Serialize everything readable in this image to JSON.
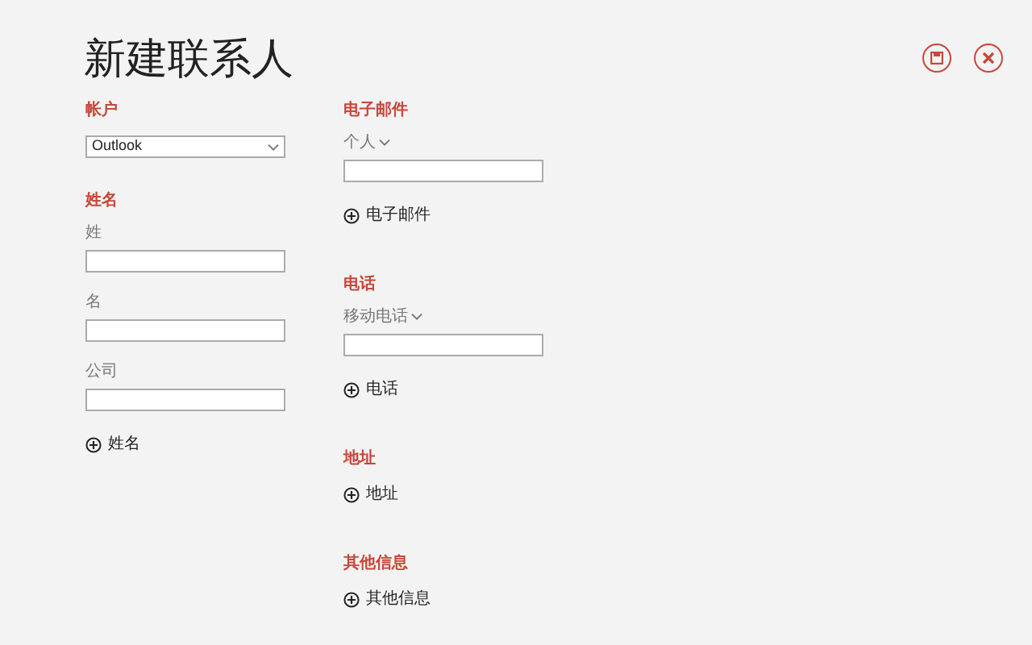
{
  "title": "新建联系人",
  "columns": [
    {
      "sections": [
        {
          "heading": "帐户",
          "items": [
            {
              "kind": "select",
              "value": "Outlook"
            }
          ]
        },
        {
          "heading": "姓名",
          "items": [
            {
              "kind": "field",
              "label": "姓"
            },
            {
              "kind": "field",
              "label": "名"
            },
            {
              "kind": "field",
              "label": "公司"
            },
            {
              "kind": "add",
              "label": "姓名"
            }
          ]
        }
      ]
    },
    {
      "sections": [
        {
          "heading": "电子邮件",
          "items": [
            {
              "kind": "typed_field",
              "label": "个人"
            },
            {
              "kind": "add",
              "label": "电子邮件"
            }
          ]
        },
        {
          "heading": "电话",
          "items": [
            {
              "kind": "typed_field",
              "label": "移动电话"
            },
            {
              "kind": "add",
              "label": "电话"
            }
          ]
        },
        {
          "heading": "地址",
          "items": [
            {
              "kind": "add",
              "label": "地址"
            }
          ]
        },
        {
          "heading": "其他信息",
          "items": [
            {
              "kind": "add",
              "label": "其他信息"
            }
          ]
        }
      ]
    }
  ]
}
